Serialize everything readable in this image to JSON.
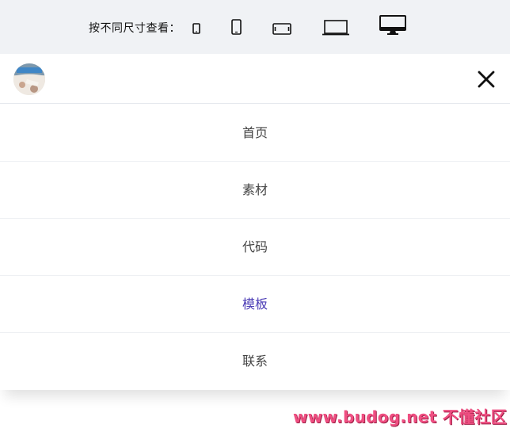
{
  "topbar": {
    "label": "按不同尺寸查看：",
    "devices": [
      {
        "name": "phone-small-icon"
      },
      {
        "name": "phone-icon"
      },
      {
        "name": "tablet-landscape-icon"
      },
      {
        "name": "laptop-icon"
      },
      {
        "name": "desktop-icon"
      }
    ]
  },
  "header": {
    "avatar": "avatar-image",
    "close_icon": "close-icon"
  },
  "menu": {
    "items": [
      {
        "label": "首页",
        "active": false
      },
      {
        "label": "素材",
        "active": false
      },
      {
        "label": "代码",
        "active": false
      },
      {
        "label": "模板",
        "active": true
      },
      {
        "label": "联系",
        "active": false
      }
    ],
    "active_color": "#4a3bb5"
  },
  "watermark": "www.budog.net 不懂社区"
}
